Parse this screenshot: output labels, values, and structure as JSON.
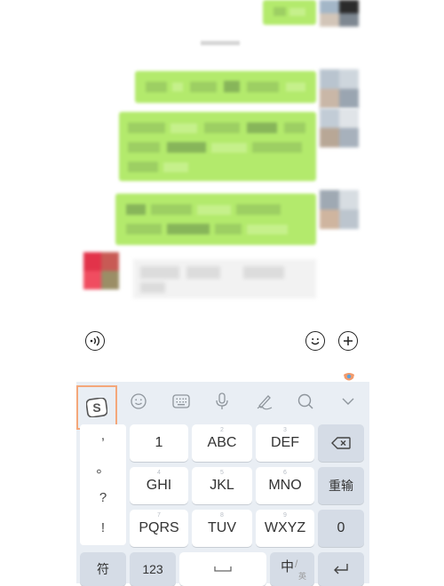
{
  "toolbar": {
    "voice_icon": "voice-wave-icon",
    "emoji_icon": "smile-icon",
    "more_icon": "plus-icon"
  },
  "keyboard": {
    "toolbar_icons": [
      "sogou-logo-icon",
      "emoji-face-icon",
      "keyboard-icon",
      "microphone-icon",
      "handwriting-pen-icon",
      "search-icon",
      "chevron-down-icon"
    ],
    "punctuation": [
      ",",
      "。",
      "?",
      "!"
    ],
    "rows": [
      [
        "1",
        "ABC",
        "DEF"
      ],
      [
        "GHI",
        "JKL",
        "MNO"
      ],
      [
        "PQRS",
        "TUV",
        "WXYZ"
      ]
    ],
    "backspace_icon": "backspace-icon",
    "enter_label": "重输",
    "zero_label": "0",
    "symbol_label": "符",
    "number_label": "123",
    "space_icon": "space-bar-icon",
    "lang_main": "中",
    "lang_sub": "英",
    "return_icon": "return-icon"
  },
  "colors": {
    "bubble_green": "#b3ea6c",
    "keyboard_bg": "#e9eef4",
    "dark_key": "#d5dce6",
    "highlight_orange": "#f4a77a"
  }
}
